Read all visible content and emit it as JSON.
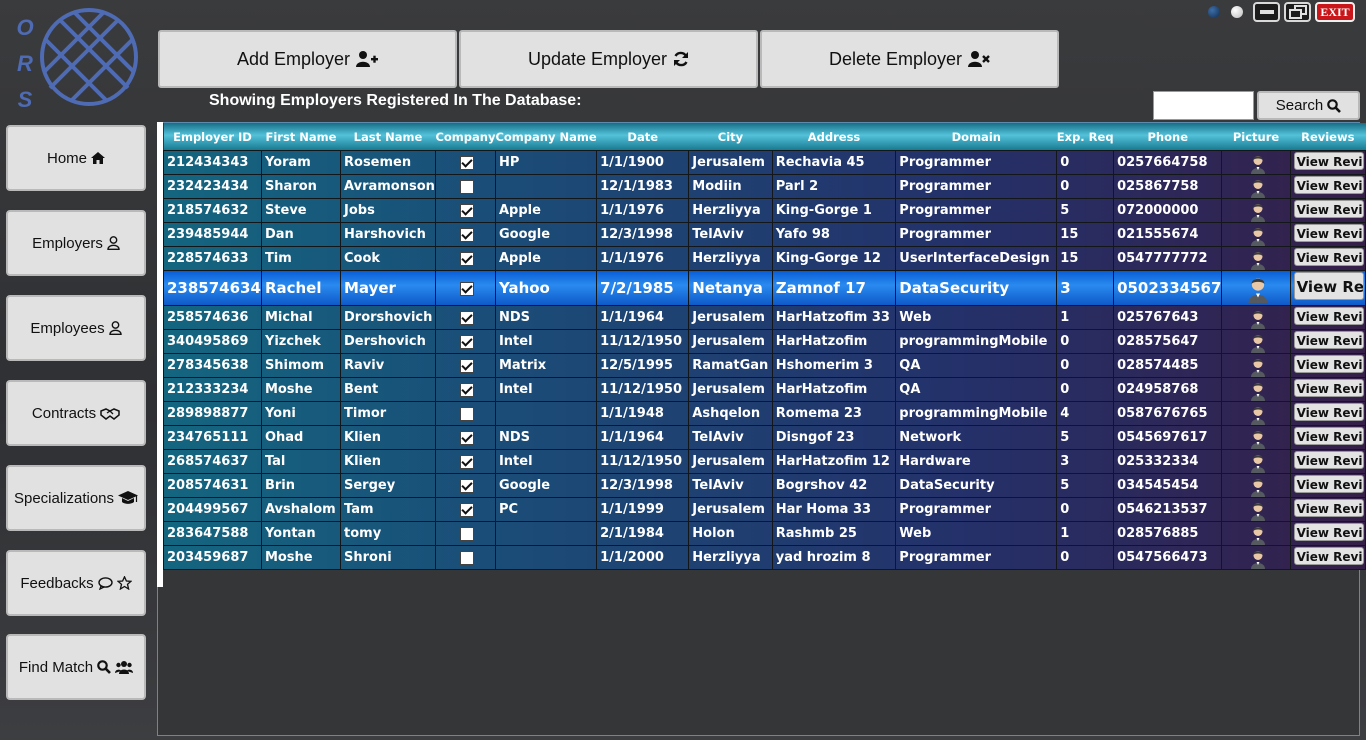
{
  "logo": {
    "letters": [
      "O",
      "R",
      "S"
    ]
  },
  "window": {
    "exit_label": "EXIT"
  },
  "toolbar": {
    "add_label": "Add Employer",
    "update_label": "Update Employer",
    "delete_label": "Delete Employer"
  },
  "caption": "Showing Employers Registered In The Database:",
  "search": {
    "placeholder": "",
    "button_label": "Search"
  },
  "sidebar": {
    "items": [
      {
        "label": "Home",
        "icon": "home-icon"
      },
      {
        "label": "Employers",
        "icon": "user-icon"
      },
      {
        "label": "Employees",
        "icon": "user-icon"
      },
      {
        "label": "Contracts",
        "icon": "handshake-icon"
      },
      {
        "label": "Specializations",
        "icon": "graduation-cap-icon"
      },
      {
        "label": "Feedbacks",
        "icon": "comment-star-icon"
      },
      {
        "label": "Find Match",
        "icon": "search-users-icon"
      }
    ]
  },
  "table": {
    "columns": [
      "Employer ID",
      "First Name",
      "Last Name",
      "Company",
      "Company Name",
      "Date",
      "City",
      "Address",
      "Domain",
      "Exp. Req",
      "Phone",
      "Picture",
      "Reviews"
    ],
    "review_label": "View Revie",
    "selected_review_label": "View Rev",
    "selected_index": 5,
    "rows": [
      [
        "212434343",
        "Yoram",
        "Rosemen",
        true,
        "HP",
        "1/1/1900",
        "Jerusalem",
        "Rechavia 45",
        "Programmer",
        "0",
        "0257664758"
      ],
      [
        "232423434",
        "Sharon",
        "Avramonson",
        false,
        "",
        "12/1/1983",
        "Modiin",
        "Parl 2",
        "Programmer",
        "0",
        "025867758"
      ],
      [
        "218574632",
        "Steve",
        "Jobs",
        true,
        "Apple",
        "1/1/1976",
        "Herzliyya",
        "King-Gorge 1",
        "Programmer",
        "5",
        "072000000"
      ],
      [
        "239485944",
        "Dan",
        "Harshovich",
        true,
        "Google",
        "12/3/1998",
        "TelAviv",
        "Yafo 98",
        "Programmer",
        "15",
        "021555674"
      ],
      [
        "228574633",
        "Tim",
        "Cook",
        true,
        "Apple",
        "1/1/1976",
        "Herzliyya",
        "King-Gorge 12",
        "UserInterfaceDesign",
        "15",
        "0547777772"
      ],
      [
        "238574634",
        "Rachel",
        "Mayer",
        true,
        "Yahoo",
        "7/2/1985",
        "Netanya",
        "Zamnof 17",
        "DataSecurity",
        "3",
        "0502334567"
      ],
      [
        "258574636",
        "Michal",
        "Drorshovich",
        true,
        "NDS",
        "1/1/1964",
        "Jerusalem",
        "HarHatzofim 33",
        "Web",
        "1",
        "025767643"
      ],
      [
        "340495869",
        "Yizchek",
        "Dershovich",
        true,
        "Intel",
        "11/12/1950",
        "Jerusalem",
        "HarHatzofim",
        "programmingMobile",
        "0",
        "028575647"
      ],
      [
        "278345638",
        "Shimom",
        "Raviv",
        true,
        "Matrix",
        "12/5/1995",
        "RamatGan",
        "Hshomerim 3",
        "QA",
        "0",
        "028574485"
      ],
      [
        "212333234",
        "Moshe",
        "Bent",
        true,
        "Intel",
        "11/12/1950",
        "Jerusalem",
        "HarHatzofim",
        "QA",
        "0",
        "024958768"
      ],
      [
        "289898877",
        "Yoni",
        "Timor",
        false,
        "",
        "1/1/1948",
        "Ashqelon",
        "Romema 23",
        "programmingMobile",
        "4",
        "0587676765"
      ],
      [
        "234765111",
        "Ohad",
        "Klien",
        true,
        "NDS",
        "1/1/1964",
        "TelAviv",
        "Disngof 23",
        "Network",
        "5",
        "0545697617"
      ],
      [
        "268574637",
        "Tal",
        "Klien",
        true,
        "Intel",
        "11/12/1950",
        "Jerusalem",
        "HarHatzofim 12",
        "Hardware",
        "3",
        "025332334"
      ],
      [
        "208574631",
        "Brin",
        "Sergey",
        true,
        "Google",
        "12/3/1998",
        "TelAviv",
        "Bogrshov 42",
        "DataSecurity",
        "5",
        "034545454"
      ],
      [
        "204499567",
        "Avshalom",
        "Tam",
        true,
        "PC",
        "1/1/1999",
        "Jerusalem",
        "Har Homa 33",
        "Programmer",
        "0",
        "0546213537"
      ],
      [
        "283647588",
        "Yontan",
        "tomy",
        false,
        "",
        "2/1/1984",
        "Holon",
        "Rashmb 25",
        "Web",
        "1",
        "028576885"
      ],
      [
        "203459687",
        "Moshe",
        "Shroni",
        false,
        "",
        "1/1/2000",
        "Herzliyya",
        "yad hrozim 8",
        "Programmer",
        "0",
        "0547566473"
      ]
    ]
  }
}
